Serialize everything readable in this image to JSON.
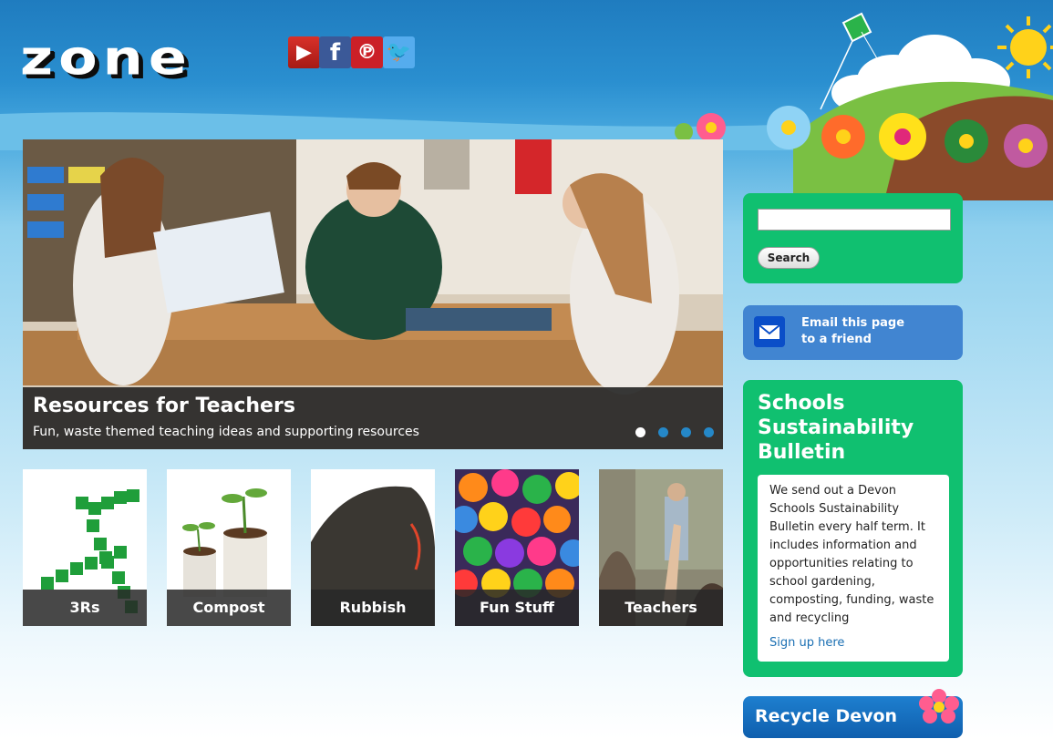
{
  "header": {
    "logo_text": "zone",
    "social": [
      {
        "name": "YouTube",
        "glyph": "▶",
        "color": "#c4241d"
      },
      {
        "name": "Facebook",
        "glyph": "f",
        "color": "#3b5998"
      },
      {
        "name": "Pinterest",
        "glyph": "℗",
        "color": "#cb2027"
      },
      {
        "name": "Twitter",
        "glyph": "🐦",
        "color": "#55acee"
      }
    ]
  },
  "hero": {
    "title": "Resources for Teachers",
    "subtitle": "Fun, waste themed teaching ideas and supporting resources",
    "dots_total": 4,
    "dots_active": 1
  },
  "tiles": [
    {
      "label": "3Rs"
    },
    {
      "label": "Compost"
    },
    {
      "label": "Rubbish"
    },
    {
      "label": "Fun Stuff"
    },
    {
      "label": "Teachers"
    }
  ],
  "search": {
    "value": "",
    "button_label": "Search"
  },
  "email": {
    "line1": "Email this page",
    "line2": "to a friend"
  },
  "bulletin": {
    "title": "Schools Sustainability Bulletin",
    "body": "We send out a Devon Schools Sustainability Bulletin every half term. It includes information and opportunities relating to school gardening, composting, funding, waste and recycling",
    "link": "Sign up here"
  },
  "recycle": {
    "label": "Recycle Devon"
  },
  "colors": {
    "green_panel": "#10c070",
    "blue_panel": "#4185d1",
    "sky": "#2b8fcf"
  }
}
